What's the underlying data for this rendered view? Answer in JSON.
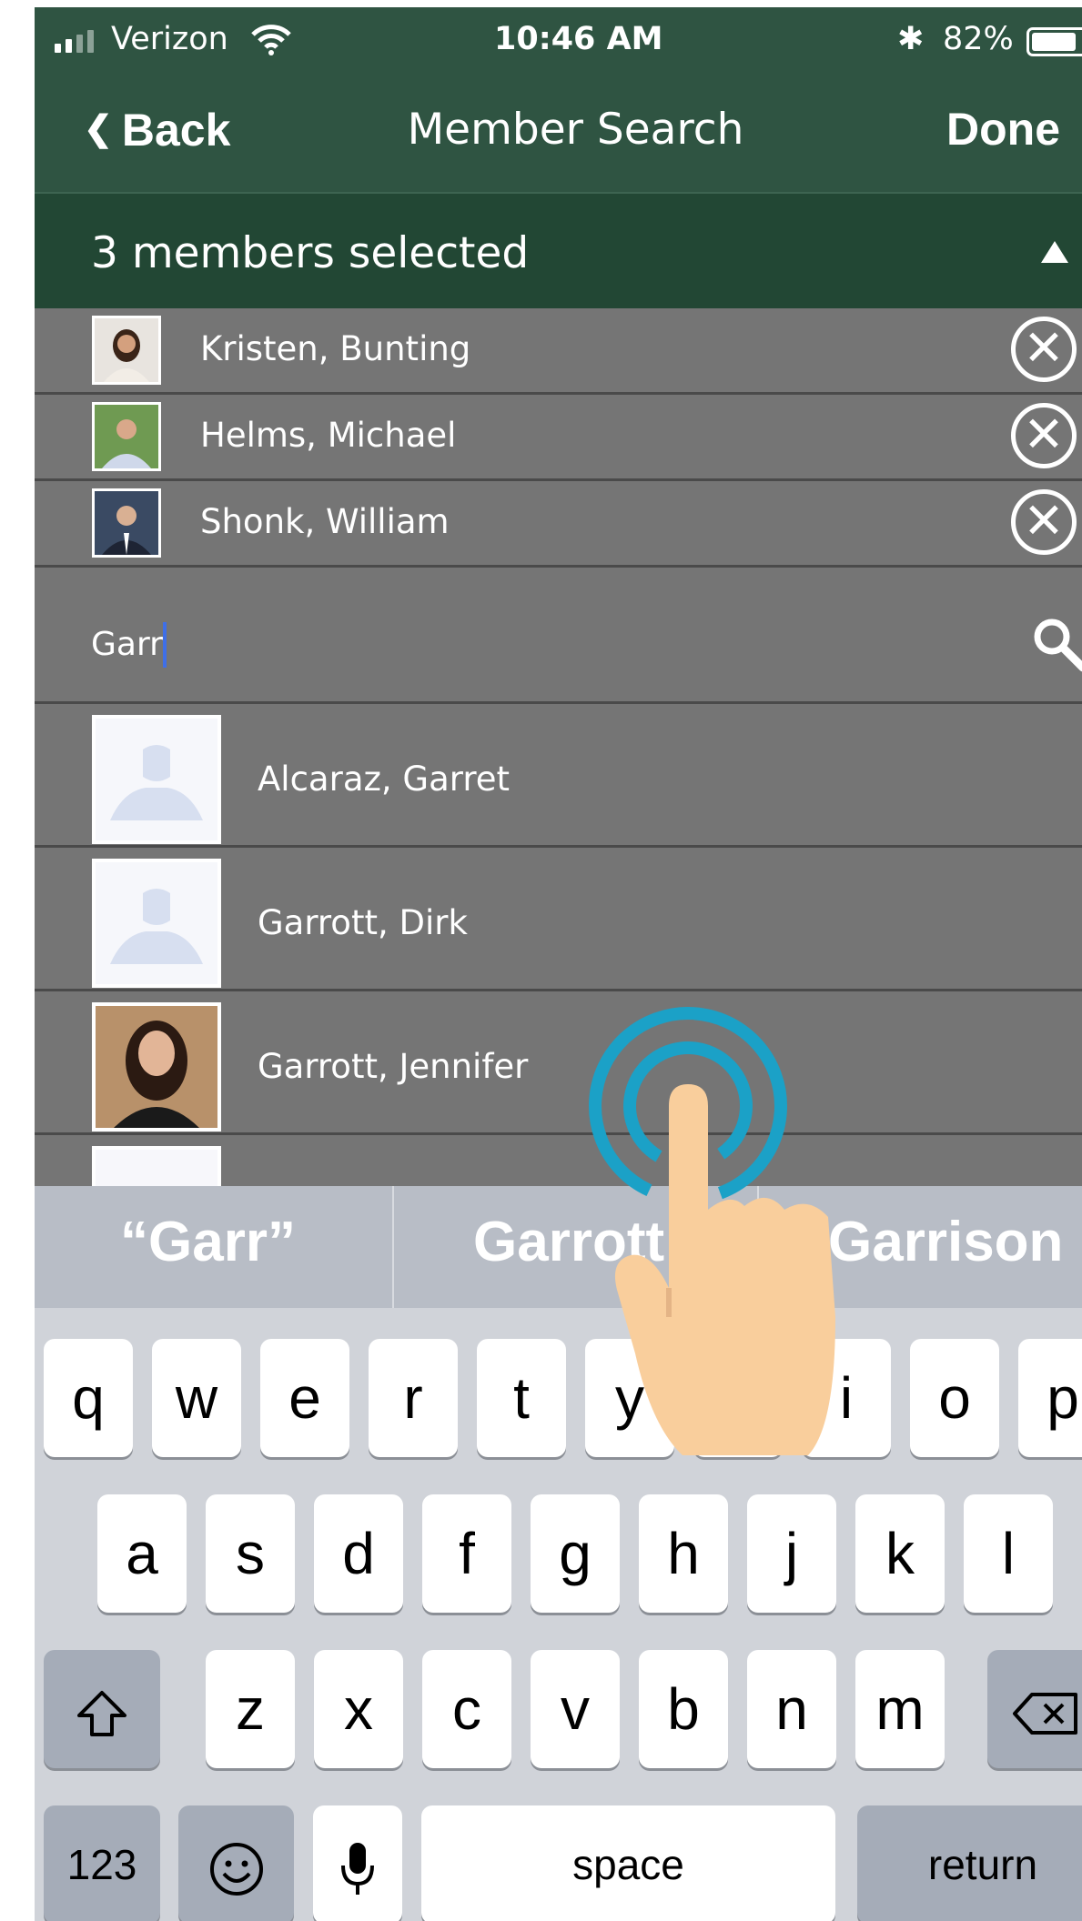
{
  "status_bar": {
    "carrier": "Verizon",
    "time": "10:46 AM",
    "battery": "82%"
  },
  "nav": {
    "back_label": "Back",
    "title": "Member Search",
    "done_label": "Done"
  },
  "selection": {
    "summary": "3 members selected"
  },
  "selected_members": [
    {
      "name": "Kristen, Bunting"
    },
    {
      "name": "Helms, Michael"
    },
    {
      "name": "Shonk, William"
    }
  ],
  "search": {
    "value": "Garr"
  },
  "results": [
    {
      "name": "Alcaraz, Garret"
    },
    {
      "name": "Garrott, Dirk"
    },
    {
      "name": "Garrott, Jennifer"
    }
  ],
  "keyboard": {
    "predictions": [
      "“Garr”",
      "Garrott",
      "Garrison"
    ],
    "row1": [
      "q",
      "w",
      "e",
      "r",
      "t",
      "y",
      "u",
      "i",
      "o",
      "p"
    ],
    "row2": [
      "a",
      "s",
      "d",
      "f",
      "g",
      "h",
      "j",
      "k",
      "l"
    ],
    "row3": [
      "z",
      "x",
      "c",
      "v",
      "b",
      "n",
      "m"
    ],
    "numbers_label": "123",
    "space_label": "space",
    "return_label": "return"
  },
  "colors": {
    "header": "#2f5442",
    "selected_bar": "#224734",
    "list_bg": "#757575",
    "caret": "#3f6fe8",
    "touch_ring": "#1ba1c7"
  }
}
